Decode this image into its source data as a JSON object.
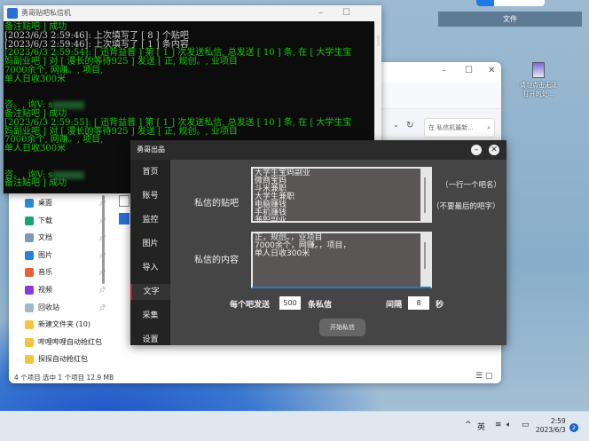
{
  "desktop": {
    "files_label": "文件",
    "icon_label": "请勿点击无法打开的处..."
  },
  "explorer": {
    "search_placeholder": "在 私信机最新...",
    "nav": [
      {
        "label": "桌面",
        "color": "#2a8ad4"
      },
      {
        "label": "下载",
        "color": "#1aa37a"
      },
      {
        "label": "文档",
        "color": "#7f98b8"
      },
      {
        "label": "图片",
        "color": "#2d7fd8"
      },
      {
        "label": "音乐",
        "color": "#e2603a"
      },
      {
        "label": "视频",
        "color": "#8a3ad8"
      },
      {
        "label": "回收站",
        "color": "#9fb8d0"
      },
      {
        "label": "新建文件夹 (10)",
        "color": "#f2c440"
      },
      {
        "label": "哔哩哔哩自动抢红包",
        "color": "#f2c440"
      },
      {
        "label": "探探自动抢红包",
        "color": "#f2c440"
      }
    ],
    "status": "4 个项目    选中 1 个项目  12.9 MB"
  },
  "console": {
    "title": "勇哥贴吧私信机",
    "lines": [
      {
        "t": "备注贴吧 ] 成功",
        "c": "g"
      },
      {
        "t": "[2023/6/3 2:59:46]: 上次填写了 [ 8 ] 个贴吧",
        "c": "w"
      },
      {
        "t": "[2023/6/3 2:59:46]: 上次填写了 [ 1 ] 条内容",
        "c": "w"
      },
      {
        "t": "[2023/6/3 2:59:54]: [ 迅背益普 ] 第 [ 1 ] 次发送私信, 总发送 [ 10 ] 条, 在 [ 大学生宝",
        "c": "g"
      },
      {
        "t": "妈副业吧 ] 对 [ 漫长的等待925 ] 发送 [ 正, 规创。, 业项目",
        "c": "g"
      },
      {
        "t": "7000余个, 网赚。, 项目,",
        "c": "g"
      },
      {
        "t": "单人日收300米",
        "c": "g"
      },
      {
        "t": "",
        "c": "g"
      },
      {
        "t": "",
        "c": "g"
      },
      {
        "t": "咨。, 询V: s",
        "c": "g",
        "blur": true
      },
      {
        "t": "备注贴吧 ] 成功",
        "c": "g"
      },
      {
        "t": "[2023/6/3 2:59:55]: [ 迅背益普 ] 第 [ 1 ] 次发送私信, 总发送 [ 10 ] 条, 在 [ 大学生宝",
        "c": "g"
      },
      {
        "t": "妈副业吧 ] 对 [ 漫长的等待925 ] 发送 [ 正, 规创。, 业项目",
        "c": "g"
      },
      {
        "t": "7000余个, 网赚。, 项目,",
        "c": "g"
      },
      {
        "t": "单人日收300米",
        "c": "g"
      },
      {
        "t": "",
        "c": "g"
      },
      {
        "t": "",
        "c": "g"
      },
      {
        "t": "咨。, 询V: s",
        "c": "g",
        "blur": true
      },
      {
        "t": "备注贴吧 ] 成功",
        "c": "g"
      }
    ]
  },
  "app": {
    "title": "勇哥出品",
    "sidebar": [
      "首页",
      "账号",
      "监控",
      "图片",
      "导入",
      "文字",
      "采集",
      "设置"
    ],
    "active": "文字",
    "bars_label": "私信的贴吧",
    "bars_value": "大学生宝妈副业\n微商宝妈\n斗米兼职\n大学生兼职\n电脑赚钱\n手机赚钱\n兼职副业",
    "hint1": "（一行一个吧名）",
    "hint2": "（不要最后的吧字）",
    "content_label": "私信的内容",
    "content_value": "正，规创。，业项目\n7000余个，网赚。，项目，\n单人日收300米",
    "per_bar_label": "每个吧发送",
    "per_bar_value": "500",
    "per_bar_unit": "条私信",
    "interval_label": "间隔",
    "interval_value": "8",
    "interval_unit": "秒",
    "start_label": "开始私信"
  },
  "taskbar": {
    "ime": "英",
    "time": "2:59",
    "date": "2023/6/3",
    "badge": "2"
  }
}
